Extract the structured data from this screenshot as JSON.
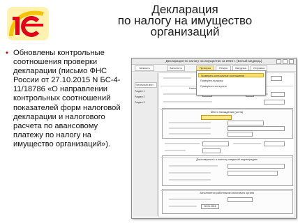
{
  "logo": {
    "text": "1С",
    "color": "#e3001b",
    "accent": "#f5c400"
  },
  "title": {
    "line1": "Декларация",
    "line2": "по налогу на имущество",
    "line3": "организаций"
  },
  "bullet": {
    "marker": "•",
    "text": "Обновлены контрольные соотношения проверки декларации (письмо ФНС России от 27.10.2015 N БС-4-11/18786 «О направлении контрольных соотношений показателей форм налоговой декларации и налогового расчета по авансовому платежу по налогу на имущество организаций»)."
  },
  "window": {
    "title": "Декларация по налогу на имущество за 2015 г. (Белый медведь)",
    "toolbar": {
      "btn_record": "Записать",
      "btn_fill": "Заполнить",
      "btn_check": "Проверка",
      "btn_print": "Печать",
      "btn_upload": "Выгрузка",
      "btn_send": "Отправка"
    },
    "menu": {
      "item1": "Проверить контрольные соотношения",
      "item2": "Проверить выгрузку",
      "item3": "Проверить в интернете"
    },
    "nav": {
      "item1": "Титульный лист",
      "item2": "Раздел 1",
      "item3": "Раздел 2",
      "item4": "Раздел 3"
    },
    "form": {
      "header": "Налоговая декларация по налогу на имущество организаций",
      "section_place": "Место нахождения (учета)",
      "section_confirm": "Достоверность и полноту сведений подтверждаю",
      "section_tax": "Заполняется работником налогового органа",
      "date_value": "30.01.2016"
    }
  }
}
